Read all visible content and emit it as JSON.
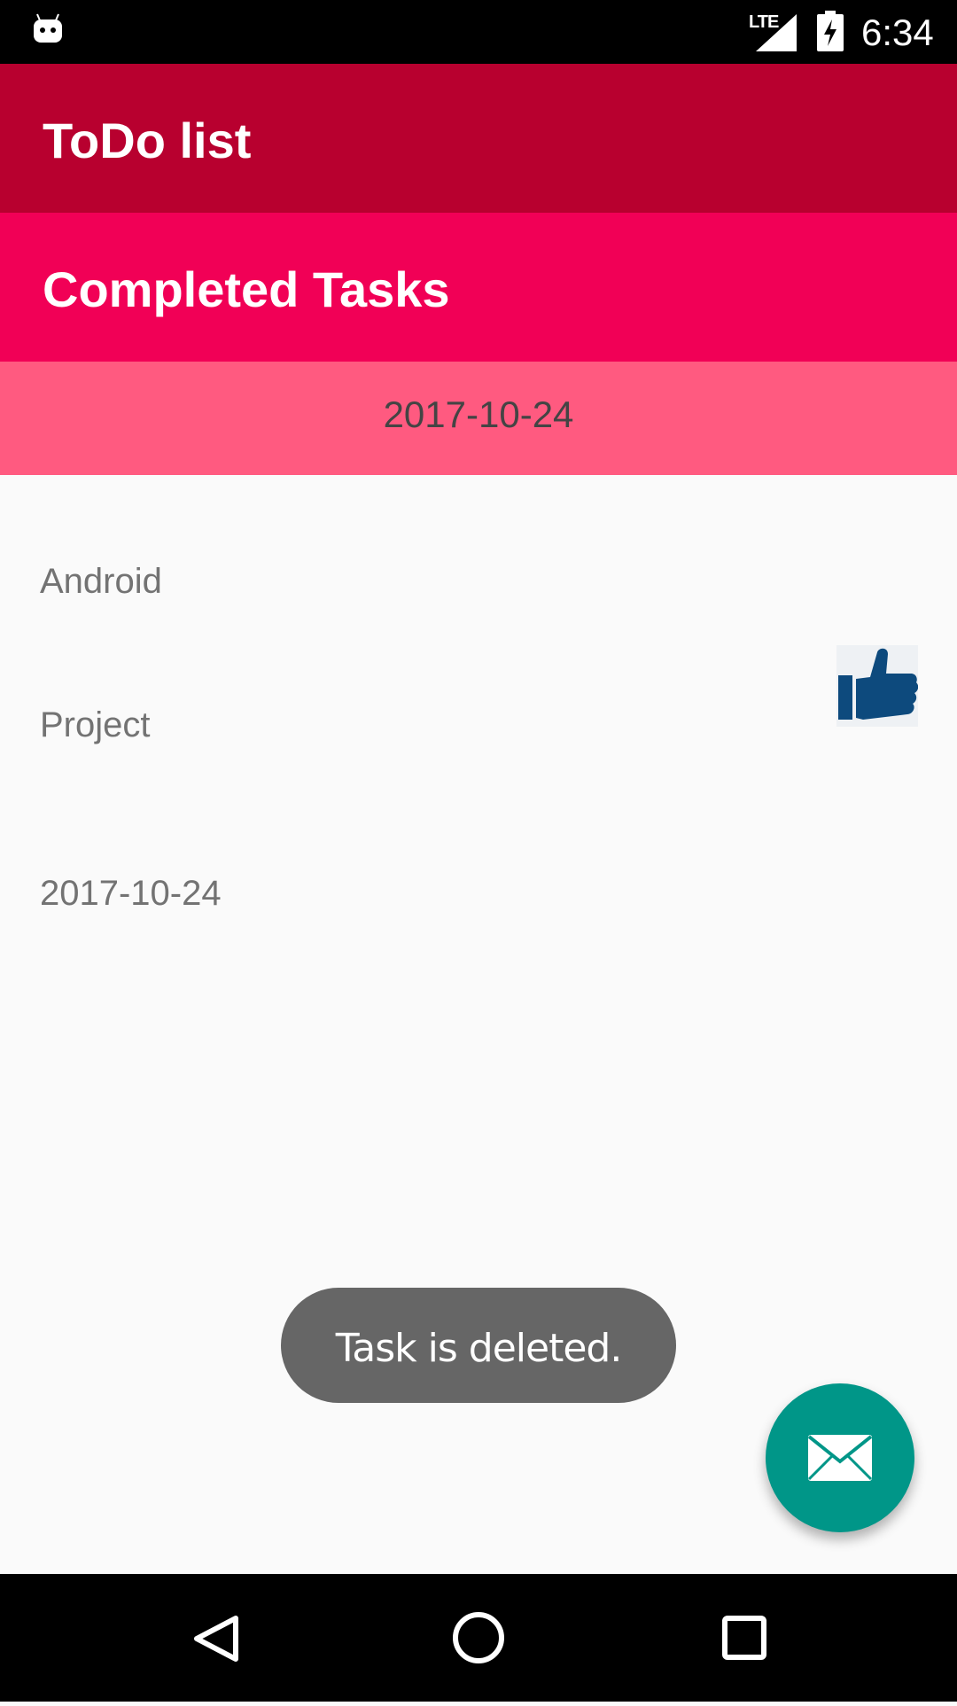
{
  "status_bar": {
    "network": "LTE",
    "time": "6:34",
    "icons": [
      "android-debug-icon",
      "signal-icon",
      "battery-charging-icon"
    ]
  },
  "app_bar": {
    "title": "ToDo list"
  },
  "section": {
    "title": "Completed Tasks"
  },
  "date_banner": {
    "date": "2017-10-24"
  },
  "task": {
    "name": "Android",
    "description": "Project",
    "date": "2017-10-24",
    "icon": "thumbs-up-icon"
  },
  "toast": {
    "message": "Task is deleted."
  },
  "fab": {
    "icon": "mail-icon",
    "color": "#009688"
  },
  "navigation": {
    "icons": [
      "back-icon",
      "home-icon",
      "recents-icon"
    ]
  },
  "colors": {
    "app_bar": "#b8002f",
    "section_bar": "#f10056",
    "date_banner": "#ff5a80",
    "thumb": "#0d4a7d"
  }
}
